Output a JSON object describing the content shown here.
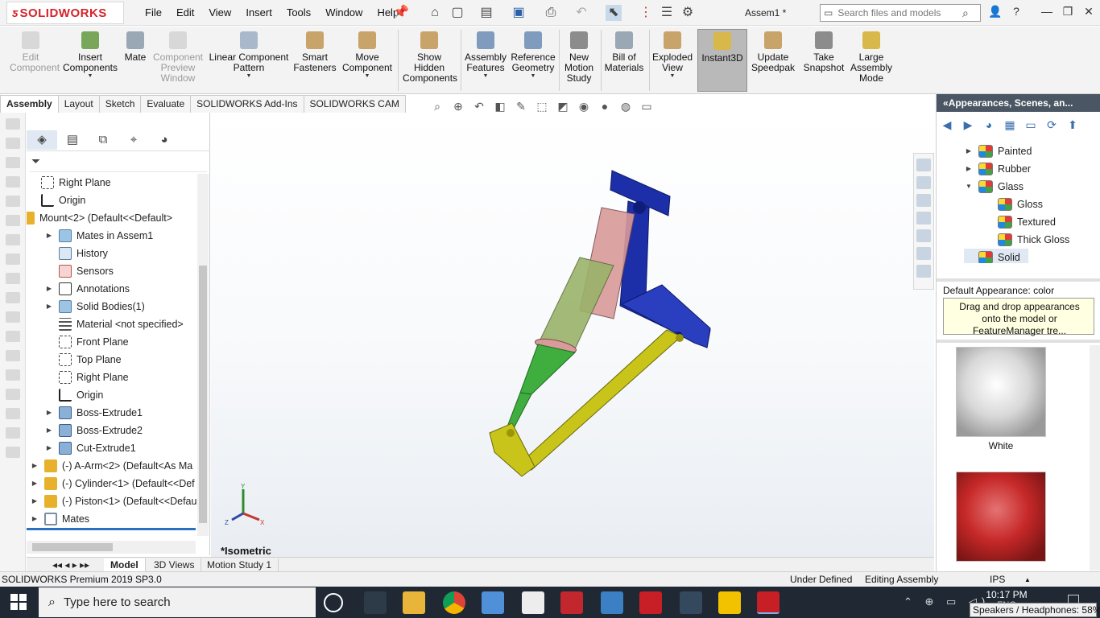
{
  "app": {
    "logo_text": "SOLIDWORKS",
    "document_title": "Assem1 *"
  },
  "menu": [
    "File",
    "Edit",
    "View",
    "Insert",
    "Tools",
    "Window",
    "Help"
  ],
  "search": {
    "placeholder": "Search files and models"
  },
  "ribbon": {
    "edit_component": "Edit Component",
    "insert_components": "Insert Components",
    "mate": "Mate",
    "component_preview": "Component Preview Window",
    "linear_pattern": "Linear Component Pattern",
    "smart_fasteners": "Smart Fasteners",
    "move_component": "Move Component",
    "show_hidden": "Show Hidden Components",
    "assembly_features": "Assembly Features",
    "reference_geometry": "Reference Geometry",
    "new_motion_study": "New Motion Study",
    "bill_of_materials": "Bill of Materials",
    "exploded_view": "Exploded View",
    "instant3d": "Instant3D",
    "update_speedpak": "Update Speedpak",
    "take_snapshot": "Take Snapshot",
    "large_assembly_mode": "Large Assembly Mode"
  },
  "tabs": [
    "Assembly",
    "Layout",
    "Sketch",
    "Evaluate",
    "SOLIDWORKS Add-Ins",
    "SOLIDWORKS CAM"
  ],
  "tree": [
    {
      "label": "Right Plane"
    },
    {
      "label": "Origin"
    },
    {
      "label": "Mount<2> (Default<<Default>"
    },
    {
      "label": "Mates in Assem1"
    },
    {
      "label": "History"
    },
    {
      "label": "Sensors"
    },
    {
      "label": "Annotations"
    },
    {
      "label": "Solid Bodies(1)"
    },
    {
      "label": "Material <not specified>"
    },
    {
      "label": "Front Plane"
    },
    {
      "label": "Top Plane"
    },
    {
      "label": "Right Plane"
    },
    {
      "label": "Origin"
    },
    {
      "label": "Boss-Extrude1"
    },
    {
      "label": "Boss-Extrude2"
    },
    {
      "label": "Cut-Extrude1"
    },
    {
      "label": "(-) A-Arm<2> (Default<As Ma"
    },
    {
      "label": "(-) Cylinder<1> (Default<<Def"
    },
    {
      "label": "(-) Piston<1> (Default<<Defau"
    },
    {
      "label": "Mates"
    }
  ],
  "viewport": {
    "view_name": "*Isometric"
  },
  "task_pane": {
    "title": "Appearances, Scenes, an...",
    "items": [
      {
        "label": "Painted"
      },
      {
        "label": "Rubber"
      },
      {
        "label": "Glass"
      },
      {
        "label": "Gloss"
      },
      {
        "label": "Textured"
      },
      {
        "label": "Thick Gloss"
      },
      {
        "label": "Solid"
      }
    ],
    "caption": "Default Appearance: color",
    "tip": "Drag and drop appearances onto the model or FeatureManager tre...",
    "swatches": [
      {
        "label": "White",
        "color": "#d8d8d8"
      },
      {
        "label": "",
        "color": "#c62828"
      }
    ]
  },
  "bottom_tabs": [
    "Model",
    "3D Views",
    "Motion Study 1"
  ],
  "status": {
    "version": "SOLIDWORKS Premium 2019 SP3.0",
    "state": "Under Defined",
    "mode": "Editing Assembly",
    "units": "IPS"
  },
  "taskbar": {
    "search_placeholder": "Type here to search",
    "time": "10:17 PM",
    "lang": "ENG",
    "speaker_tip": "Speakers / Headphones: 58%"
  },
  "colors": {
    "mount": "#1c2fa8",
    "cylinder_body": "#d99a9a",
    "piston": "#3fae3f",
    "a_arm": "#c9c41a",
    "accent": "#2a71c2"
  }
}
